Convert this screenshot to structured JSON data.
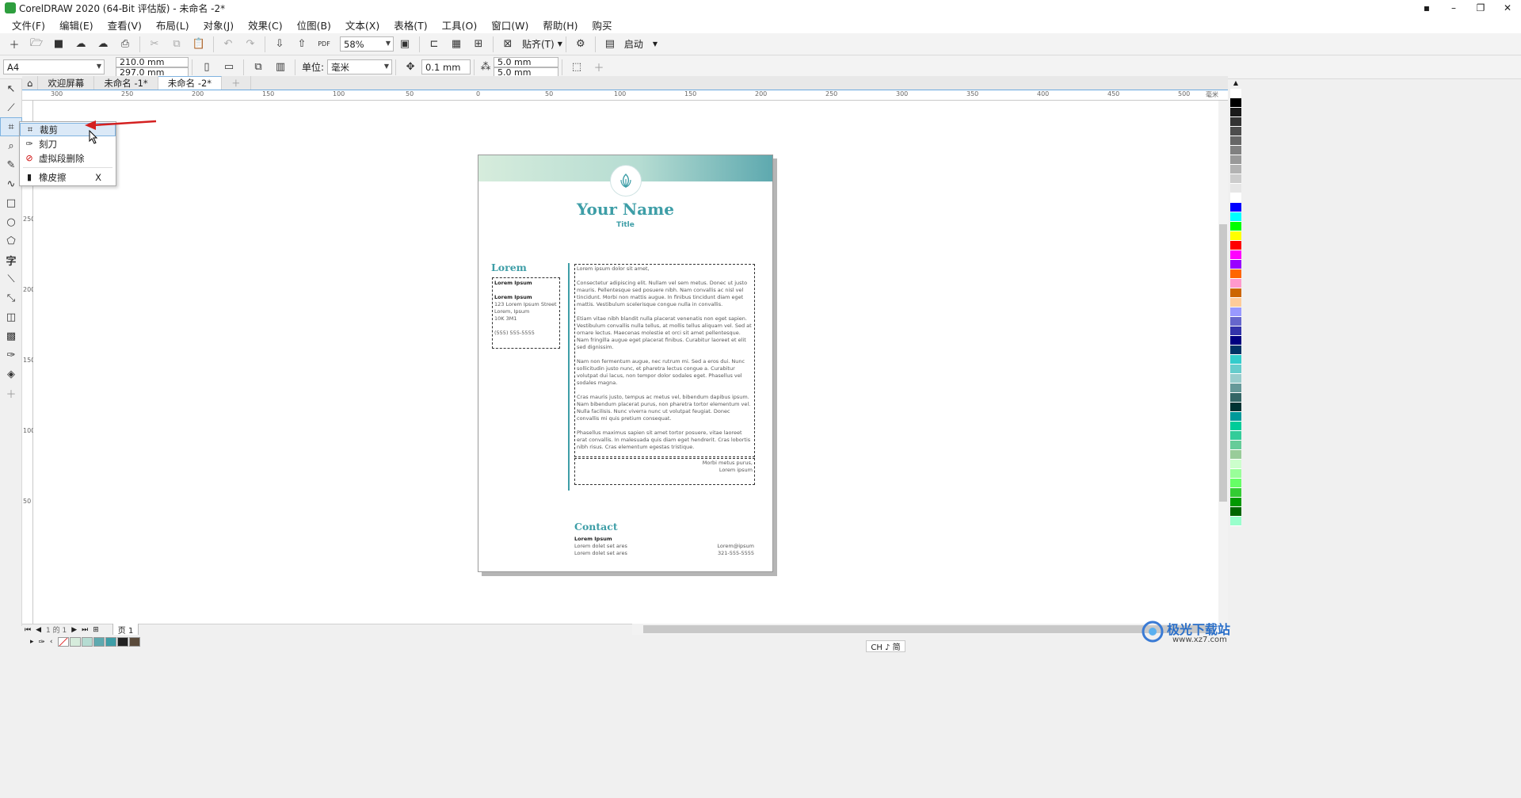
{
  "window": {
    "title": "CorelDRAW 2020 (64-Bit 评估版) - 未命名 -2*",
    "controls": [
      "▪",
      "–",
      "❐",
      "✕"
    ]
  },
  "menu": [
    "文件(F)",
    "编辑(E)",
    "查看(V)",
    "布局(L)",
    "对象(J)",
    "效果(C)",
    "位图(B)",
    "文本(X)",
    "表格(T)",
    "工具(O)",
    "窗口(W)",
    "帮助(H)",
    "购买"
  ],
  "toolbar1": {
    "zoom": "58%",
    "snap_label": "贴齐(T)",
    "launch_label": "启动"
  },
  "toolbar2": {
    "paper_size": "A4",
    "width": "210.0 mm",
    "height": "297.0 mm",
    "unit_label": "单位:",
    "unit": "毫米",
    "nudge": "0.1 mm",
    "dup_x": "5.0 mm",
    "dup_y": "5.0 mm"
  },
  "tabs": [
    "欢迎屏幕",
    "未命名 -1*",
    "未命名 -2*"
  ],
  "ruler": {
    "h_labels": [
      "300",
      "250",
      "200",
      "150",
      "100",
      "50",
      "0",
      "50",
      "100",
      "150",
      "200",
      "250",
      "300",
      "350",
      "400",
      "450",
      "500"
    ],
    "h_unit": "毫米",
    "v_labels": [
      "250",
      "200",
      "150",
      "100",
      "50"
    ]
  },
  "flyout": {
    "items": [
      {
        "label": "裁剪",
        "icon": "crop-icon",
        "shortcut": ""
      },
      {
        "label": "刻刀",
        "icon": "knife-icon",
        "shortcut": ""
      },
      {
        "label": "虚拟段删除",
        "icon": "virtual-segment-delete-icon",
        "shortcut": ""
      },
      {
        "label": "橡皮擦",
        "icon": "eraser-icon",
        "shortcut": "X"
      }
    ]
  },
  "document": {
    "name": "Your Name",
    "title": "Title",
    "left_heading": "Lorem",
    "left_box": [
      "Lorem Ipsum",
      "Lorem Ipsum",
      "123 Lorem Ipsum Street",
      "Lorem, Ipsum",
      "10K 3M1",
      "(555) 555-5555"
    ],
    "body_paragraphs": [
      "Lorem ipsum dolor sit amet,",
      "Consectetur adipiscing elit. Nullam vel sem metus. Donec ut justo mauris. Pellentesque sed posuere nibh. Nam convallis ac nisl vel tincidunt. Morbi non mattis augue. In finibus tincidunt diam eget mattis. Vestibulum scelerisque congue nulla in convallis.",
      "Etiam vitae nibh blandit nulla placerat venenatis non eget sapien. Vestibulum convallis nulla tellus, at mollis tellus aliquam vel. Sed at ornare lectus. Maecenas molestie et orci sit amet pellentesque. Nam fringilla augue eget placerat finibus. Curabitur laoreet et elit sed dignissim.",
      "Nam non fermentum augue, nec rutrum mi. Sed a eros dui. Nunc sollicitudin justo nunc, et pharetra lectus congue a. Curabitur volutpat dui lacus, non tempor dolor sodales eget. Phasellus vel sodales magna.",
      "Cras mauris justo, tempus ac metus vel, bibendum dapibus ipsum. Nam bibendum placerat purus, non pharetra tortor elementum vel. Nulla facilisis. Nunc viverra nunc ut volutpat feugiat. Donec convallis mi quis pretium consequat.",
      "Phasellus maximus sapien sit amet tortor posuere, vitae laoreet erat convallis. In malesuada quis diam eget hendrerit. Cras lobortis nibh risus. Cras elementum egestas tristique."
    ],
    "closing": [
      "Morbi metus purus,",
      "Lorem ipsum"
    ],
    "contact_heading": "Contact",
    "contact_name": "Lorem Ipsum",
    "contact_left": [
      "Lorem dolet set ares",
      "Lorem dolet set ares"
    ],
    "contact_right": [
      "Lorem@ipsum",
      "321-555-5555"
    ]
  },
  "pagebar": {
    "page_info": "1 的 1",
    "page_tab": "页 1"
  },
  "status": {
    "ime": "CH ♪ 简"
  },
  "watermark": {
    "text": "极光下载站",
    "url": "www.xz7.com"
  },
  "palette_colors": [
    "#ffffff",
    "#000000",
    "#1a1a1a",
    "#333333",
    "#4d4d4d",
    "#666666",
    "#808080",
    "#999999",
    "#b3b3b3",
    "#cccccc",
    "#e6e6e6",
    "#ffffff",
    "#0000ff",
    "#00ffff",
    "#00ff00",
    "#ffff00",
    "#ff0000",
    "#ff00ff",
    "#9900ff",
    "#ff6600",
    "#ff99cc",
    "#cc6600",
    "#ffcc99",
    "#9999ff",
    "#6666cc",
    "#3333aa",
    "#000080",
    "#003366",
    "#33cccc",
    "#66cccc",
    "#99cccc",
    "#669999",
    "#336666",
    "#003333",
    "#009999",
    "#00cc99",
    "#33cc99",
    "#66cc99",
    "#99cc99",
    "#ccffcc",
    "#99ff99",
    "#66ff66",
    "#33cc33",
    "#009900",
    "#006600",
    "#99ffcc"
  ],
  "status_swatches": [
    "#d6ecdc",
    "#b5dcd2",
    "#5ea9af",
    "#3e9ea7",
    "#222222",
    "#5a4a3a"
  ]
}
